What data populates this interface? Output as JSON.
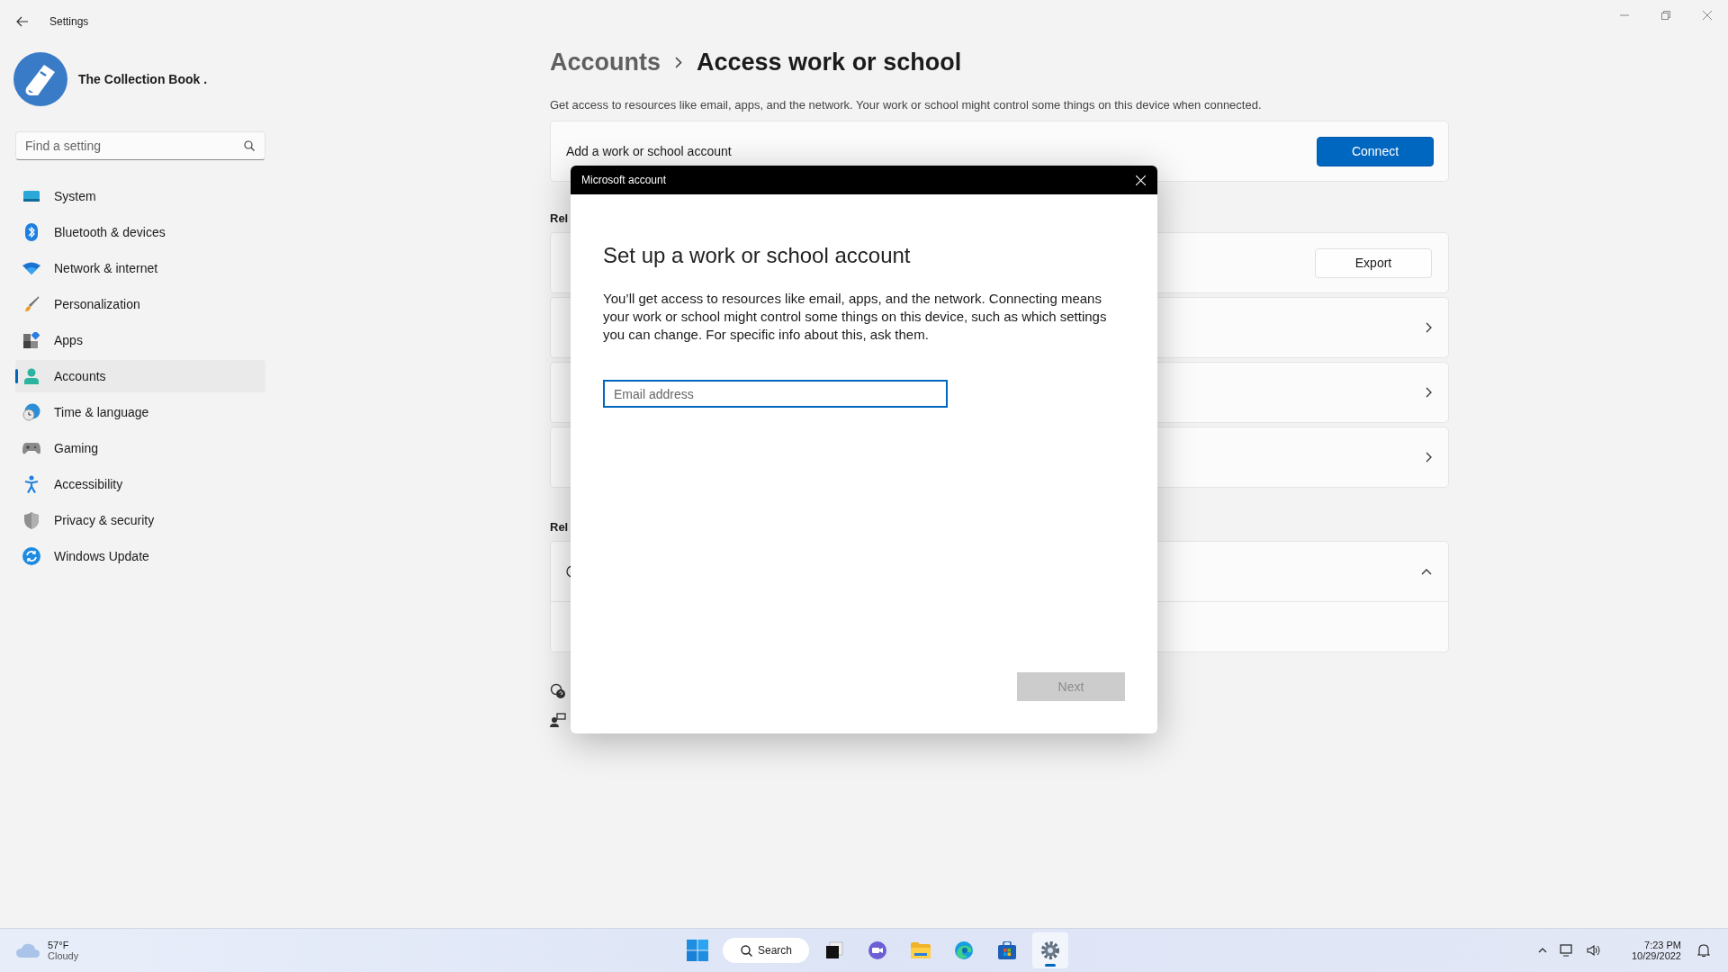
{
  "window": {
    "title": "Settings"
  },
  "profile": {
    "name": "The Collection Book ."
  },
  "search": {
    "placeholder": "Find a setting"
  },
  "nav": [
    {
      "label": "System",
      "selected": false
    },
    {
      "label": "Bluetooth & devices",
      "selected": false
    },
    {
      "label": "Network & internet",
      "selected": false
    },
    {
      "label": "Personalization",
      "selected": false
    },
    {
      "label": "Apps",
      "selected": false
    },
    {
      "label": "Accounts",
      "selected": true
    },
    {
      "label": "Time & language",
      "selected": false
    },
    {
      "label": "Gaming",
      "selected": false
    },
    {
      "label": "Accessibility",
      "selected": false
    },
    {
      "label": "Privacy & security",
      "selected": false
    },
    {
      "label": "Windows Update",
      "selected": false
    }
  ],
  "breadcrumb": {
    "parent": "Accounts",
    "current": "Access work or school"
  },
  "description": "Get access to resources like email, apps, and the network. Your work or school might control some things on this device when connected.",
  "add_account": {
    "label": "Add a work or school account",
    "button": "Connect"
  },
  "related_heading": "Rel",
  "rows": [
    {
      "kind": "button",
      "button": "Export"
    },
    {
      "kind": "link"
    },
    {
      "kind": "link"
    },
    {
      "kind": "link"
    }
  ],
  "related2_heading": "Rel",
  "expander": {
    "expanded": true
  },
  "dialog": {
    "title": "Microsoft account",
    "heading": "Set up a work or school account",
    "body": "You’ll get access to resources like email, apps, and the network. Connecting means your work or school might control some things on this device, such as which settings you can change. For specific info about this, ask them.",
    "email": {
      "placeholder": "Email address"
    },
    "next": {
      "label": "Next",
      "disabled": true
    }
  },
  "taskbar": {
    "weather": {
      "temp": "57°F",
      "condition": "Cloudy"
    },
    "search": "Search",
    "apps": [
      {
        "selected": false
      },
      {
        "selected": false
      },
      {
        "selected": false
      },
      {
        "selected": false
      },
      {
        "selected": false
      },
      {
        "selected": true
      }
    ],
    "time": "7:23 PM",
    "date": "10/29/2022"
  }
}
